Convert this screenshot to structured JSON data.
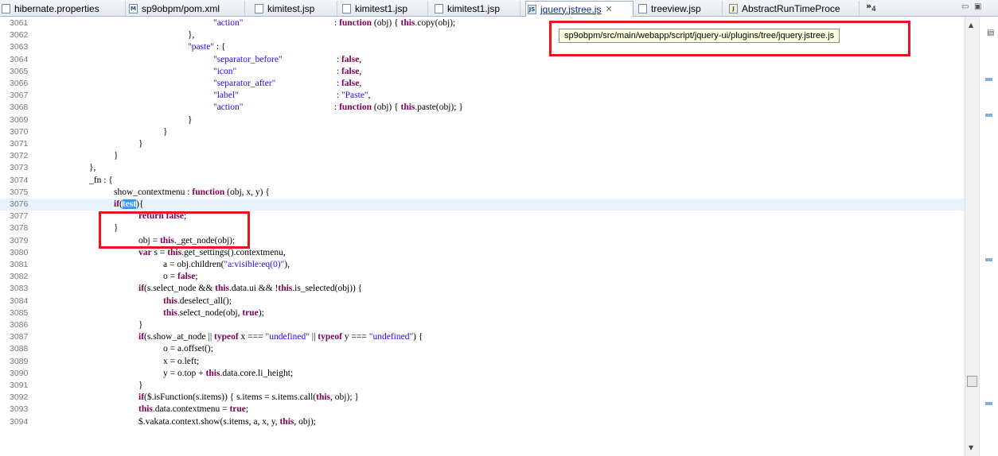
{
  "tabs": [
    {
      "label": "hibernate.properties",
      "icon": "properties-file-icon"
    },
    {
      "label": "sp9obpm/pom.xml",
      "icon": "maven-pom-icon"
    },
    {
      "label": "kimitest.jsp",
      "icon": "jsp-file-icon"
    },
    {
      "label": "kimitest1.jsp",
      "icon": "jsp-file-icon"
    },
    {
      "label": "kimitest1.jsp",
      "icon": "jsp-file-icon"
    },
    {
      "label": "jquery.jstree.js",
      "icon": "js-file-icon",
      "active": true
    },
    {
      "label": "treeview.jsp",
      "icon": "jsp-file-icon"
    },
    {
      "label": "AbstractRunTimeProce",
      "icon": "java-file-icon"
    }
  ],
  "tab_overflow": {
    "glyph": "»",
    "count": "4"
  },
  "tooltip": "sp9obpm/src/main/webapp/script/jquery-ui/plugins/tree/jquery.jstree.js",
  "line_numbers": [
    "3061",
    "3062",
    "3063",
    "3064",
    "3065",
    "3066",
    "3067",
    "3068",
    "3069",
    "3070",
    "3071",
    "3072",
    "3073",
    "3074",
    "3075",
    "3076",
    "3077",
    "3078",
    "3079",
    "3080",
    "3081",
    "3082",
    "3083",
    "3084",
    "3085",
    "3086",
    "3087",
    "3088",
    "3089",
    "3090",
    "3091",
    "3092",
    "3093",
    "3094"
  ],
  "code": {
    "l3061": [
      "\"action\"",
      ": ",
      "function",
      " (obj) { ",
      "this",
      ".copy(obj);"
    ],
    "l3062": "},",
    "l3063": [
      "\"paste\"",
      " : {"
    ],
    "l3064": [
      "\"separator_before\"",
      " : ",
      "false",
      ","
    ],
    "l3065": [
      "\"icon\"",
      " : ",
      "false",
      ","
    ],
    "l3066": [
      "\"separator_after\"",
      " : ",
      "false",
      ","
    ],
    "l3067": [
      "\"label\"",
      " : ",
      "\"Paste\"",
      ","
    ],
    "l3068": [
      "\"action\"",
      ": ",
      "function",
      " (obj) { ",
      "this",
      ".paste(obj); }"
    ],
    "l3069": "}",
    "l3070": "}",
    "l3071": "}",
    "l3072": "}",
    "l3073": "},",
    "l3074": "_fn : {",
    "l3075": [
      "show_contextmenu : ",
      "function",
      " (obj, x, y) {"
    ],
    "l3076": [
      "if",
      "(",
      "test",
      "){"
    ],
    "l3077": [
      "return",
      " ",
      "false",
      ";"
    ],
    "l3078": "}",
    "l3079": [
      "obj = ",
      "this",
      "._get_node(obj);"
    ],
    "l3080": [
      "var",
      " s = ",
      "this",
      ".get_settings().contextmenu,"
    ],
    "l3081": [
      "a = obj.children(",
      "\"a:visible:eq(0)\"",
      "),"
    ],
    "l3082": [
      "o = ",
      "false",
      ";"
    ],
    "l3083": [
      "if",
      "(s.select_node && ",
      "this",
      ".data.ui && !",
      "this",
      ".is_selected(obj)) {"
    ],
    "l3084": [
      "this",
      ".deselect_all();"
    ],
    "l3085": [
      "this",
      ".select_node(obj, ",
      "true",
      ");"
    ],
    "l3086": "}",
    "l3087": [
      "if",
      "(s.show_at_node || ",
      "typeof",
      " x === ",
      "\"undefined\"",
      " || ",
      "typeof",
      " y === ",
      "\"undefined\"",
      ") {"
    ],
    "l3088": "o = a.offset();",
    "l3089": "x = o.left;",
    "l3090": [
      "y = o.top + ",
      "this",
      ".data.core.li_height;"
    ],
    "l3091": "}",
    "l3092": [
      "if",
      "($.isFunction(s.items)) { s.items = s.items.call(",
      "this",
      ", obj); }"
    ],
    "l3093": [
      "this",
      ".data.contextmenu = ",
      "true",
      ";"
    ],
    "l3094": [
      "$.vakata.context.show(s.items, a, x, y, ",
      "this",
      ", obj);"
    ]
  },
  "colors": {
    "keyword": "#7f0055",
    "string": "#2a00ff",
    "highlight": "#e8141a",
    "selection": "#3399ff"
  }
}
